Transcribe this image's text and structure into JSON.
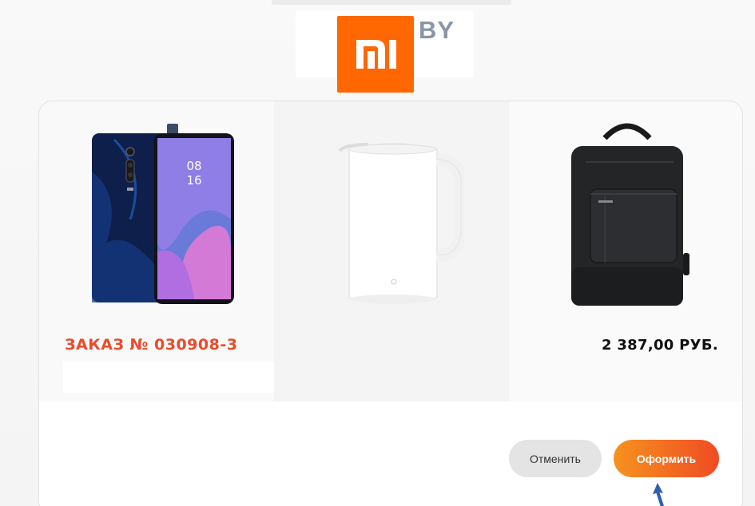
{
  "brand": {
    "logo_text": "mi",
    "suffix": "BY",
    "logo_color": "#ff6700"
  },
  "cart": {
    "products": [
      {
        "name": "phone-image",
        "icon": "smartphone"
      },
      {
        "name": "kettle-image",
        "icon": "electric-kettle"
      },
      {
        "name": "backpack-image",
        "icon": "backpack"
      }
    ],
    "order_title": "ЗАКАЗ № 030908-3",
    "total": "2 387,00 РУБ.",
    "accent_color": "#ec4a2a"
  },
  "actions": {
    "cancel_label": "Отменить",
    "submit_label": "Оформить"
  }
}
